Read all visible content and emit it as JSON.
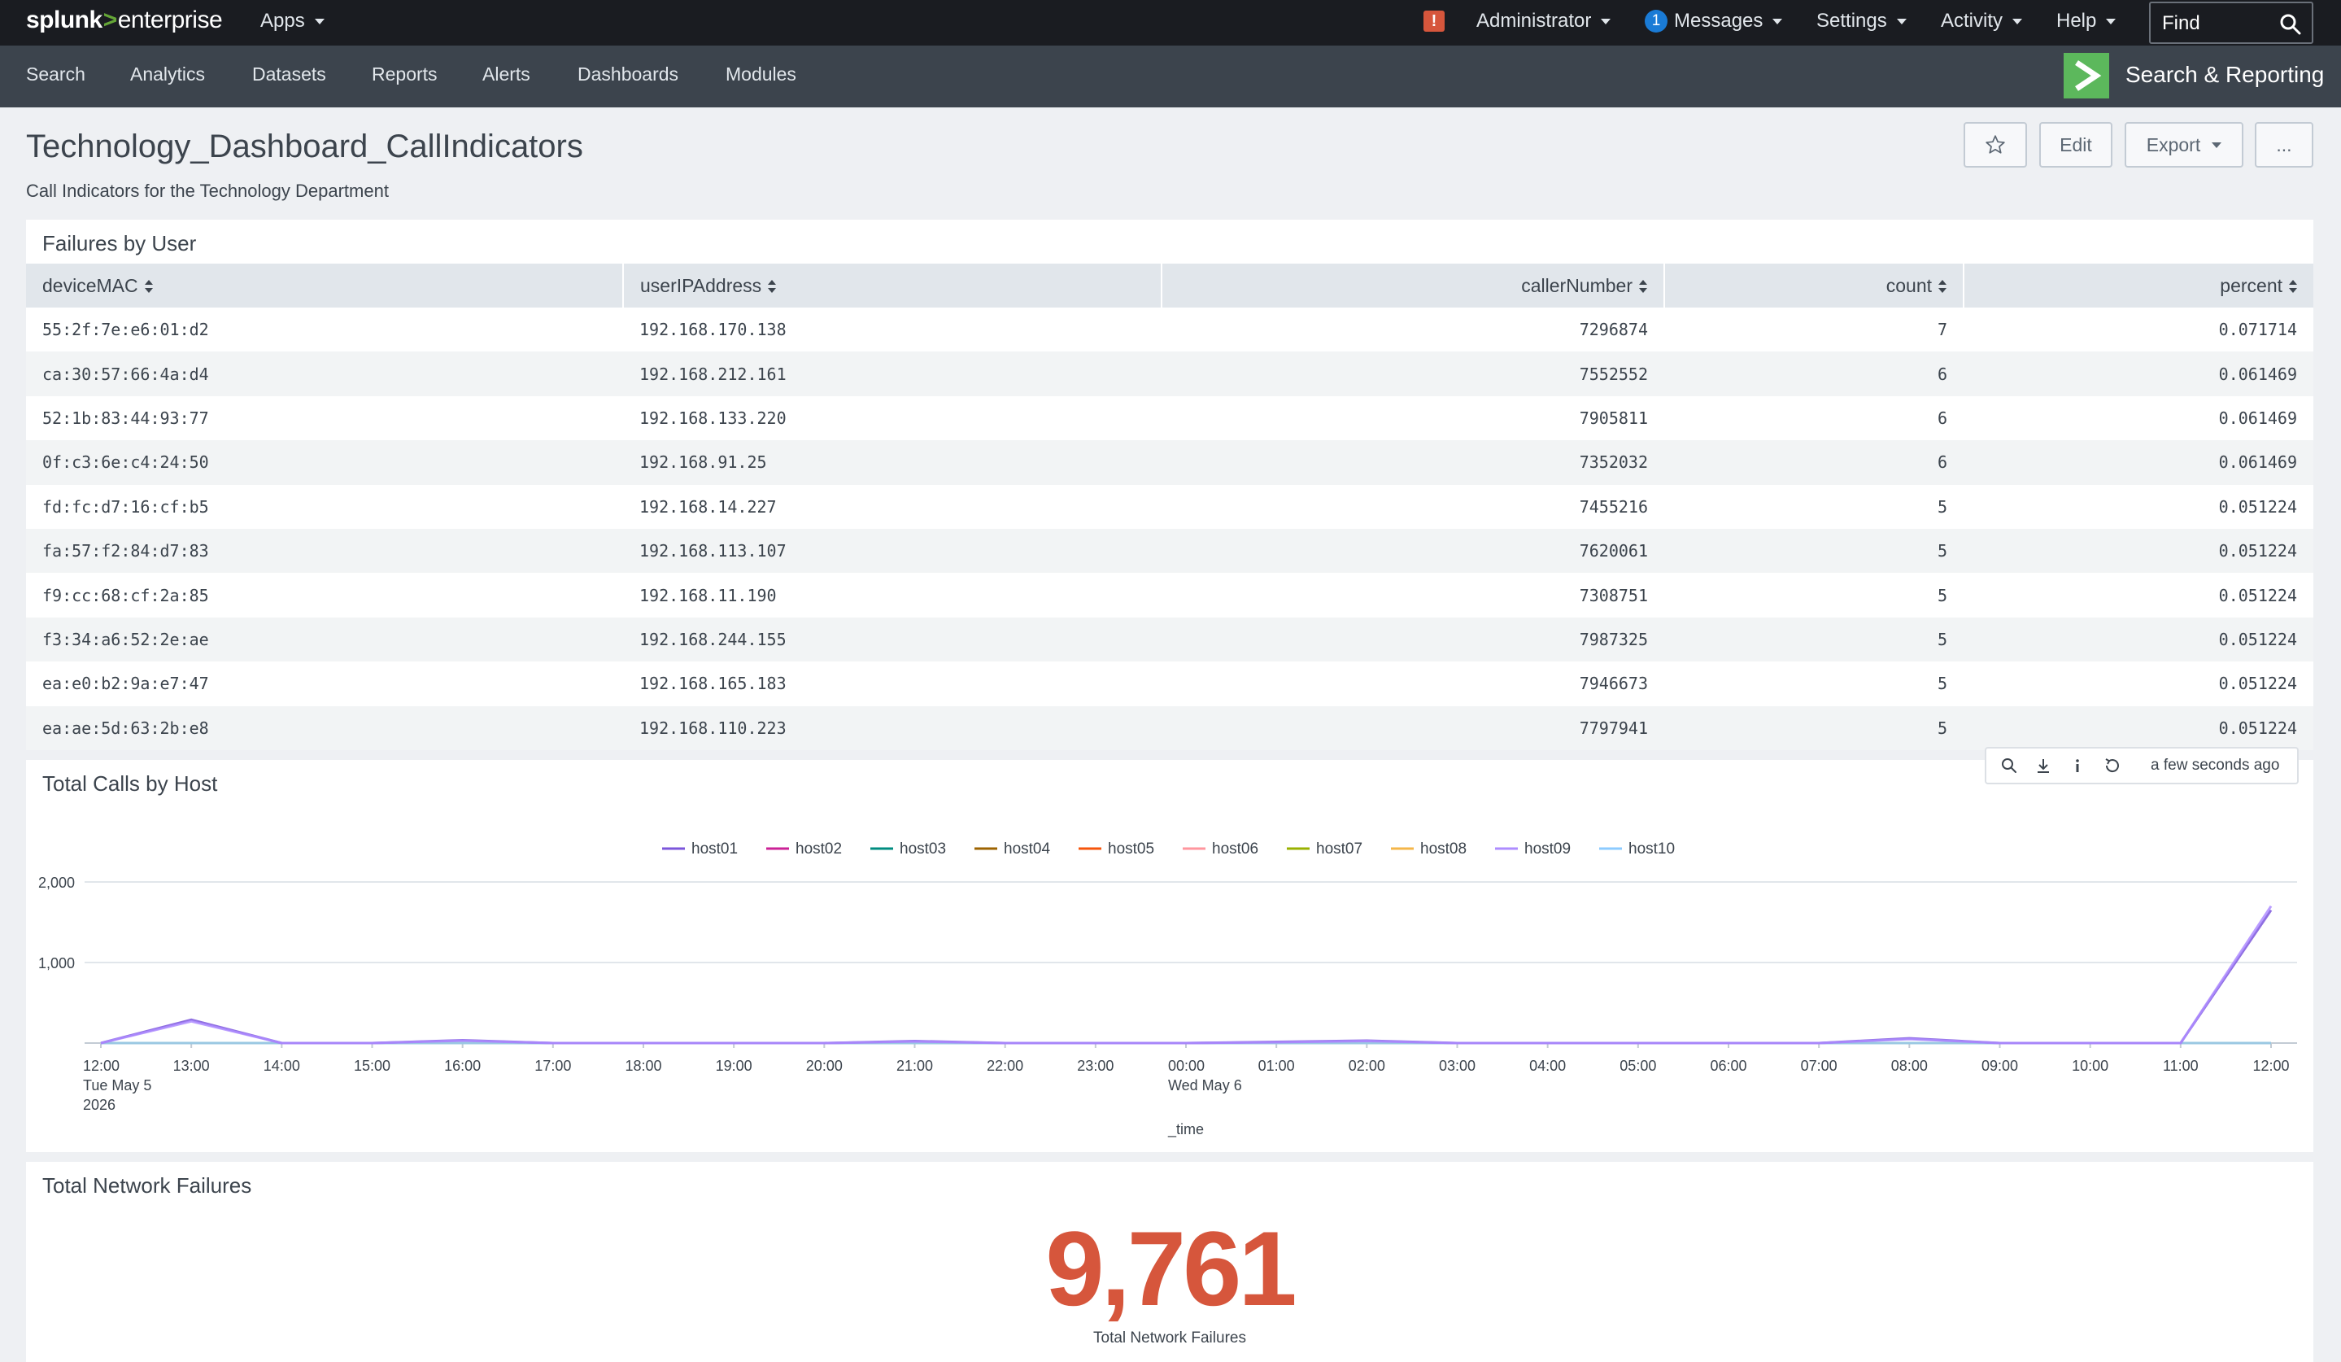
{
  "topbar": {
    "logo_splunk": "splunk",
    "logo_gt": ">",
    "logo_enterprise": "enterprise",
    "apps": "Apps",
    "alert_icon": "!",
    "user": "Administrator",
    "messages_count": "1",
    "messages": "Messages",
    "settings": "Settings",
    "activity": "Activity",
    "help": "Help",
    "find_placeholder": "Find"
  },
  "appbar": {
    "nav": [
      "Search",
      "Analytics",
      "Datasets",
      "Reports",
      "Alerts",
      "Dashboards",
      "Modules"
    ],
    "app_name": "Search & Reporting",
    "app_logo_color": "#5cb85c"
  },
  "dashboard": {
    "title": "Technology_Dashboard_CallIndicators",
    "description": "Call Indicators for the Technology Department",
    "buttons": {
      "edit": "Edit",
      "export": "Export",
      "more": "..."
    }
  },
  "failures_panel": {
    "title": "Failures by User",
    "columns": [
      "deviceMAC",
      "userIPAddress",
      "callerNumber",
      "count",
      "percent"
    ],
    "rows": [
      [
        "55:2f:7e:e6:01:d2",
        "192.168.170.138",
        "7296874",
        "7",
        "0.071714"
      ],
      [
        "ca:30:57:66:4a:d4",
        "192.168.212.161",
        "7552552",
        "6",
        "0.061469"
      ],
      [
        "52:1b:83:44:93:77",
        "192.168.133.220",
        "7905811",
        "6",
        "0.061469"
      ],
      [
        "0f:c3:6e:c4:24:50",
        "192.168.91.25",
        "7352032",
        "6",
        "0.061469"
      ],
      [
        "fd:fc:d7:16:cf:b5",
        "192.168.14.227",
        "7455216",
        "5",
        "0.051224"
      ],
      [
        "fa:57:f2:84:d7:83",
        "192.168.113.107",
        "7620061",
        "5",
        "0.051224"
      ],
      [
        "f9:cc:68:cf:2a:85",
        "192.168.11.190",
        "7308751",
        "5",
        "0.051224"
      ],
      [
        "f3:34:a6:52:2e:ae",
        "192.168.244.155",
        "7987325",
        "5",
        "0.051224"
      ],
      [
        "ea:e0:b2:9a:e7:47",
        "192.168.165.183",
        "7946673",
        "5",
        "0.051224"
      ],
      [
        "ea:ae:5d:63:2b:e8",
        "192.168.110.223",
        "7797941",
        "5",
        "0.051224"
      ]
    ]
  },
  "chart_toolbar": {
    "timestamp": "a few seconds ago"
  },
  "calls_panel": {
    "title": "Total Calls by Host"
  },
  "chart_data": {
    "type": "line",
    "title": "Total Calls by Host",
    "xlabel": "_time",
    "ylabel": "",
    "ylim": [
      0,
      2000
    ],
    "yticks": [
      {
        "value": 1000,
        "label": "1,000"
      },
      {
        "value": 2000,
        "label": "2,000"
      }
    ],
    "grid": true,
    "legend_position": "top",
    "x": [
      "12:00",
      "13:00",
      "14:00",
      "15:00",
      "16:00",
      "17:00",
      "18:00",
      "19:00",
      "20:00",
      "21:00",
      "22:00",
      "23:00",
      "00:00",
      "01:00",
      "02:00",
      "03:00",
      "04:00",
      "05:00",
      "06:00",
      "07:00",
      "08:00",
      "09:00",
      "10:00",
      "11:00",
      "12:00"
    ],
    "x_sublabels": [
      {
        "index": 0,
        "lines": [
          "Tue May 5",
          "2026"
        ]
      },
      {
        "index": 12,
        "lines": [
          "Wed May 6"
        ]
      }
    ],
    "series": [
      {
        "name": "host01",
        "color": "#7b56db",
        "values": [
          0,
          290,
          0,
          0,
          35,
          0,
          0,
          0,
          0,
          25,
          0,
          0,
          0,
          15,
          30,
          0,
          0,
          0,
          0,
          0,
          60,
          0,
          0,
          0,
          1650
        ]
      },
      {
        "name": "host02",
        "color": "#cb2196",
        "values": [
          0,
          0,
          0,
          0,
          0,
          0,
          0,
          0,
          0,
          0,
          0,
          0,
          0,
          0,
          0,
          0,
          0,
          0,
          0,
          0,
          0,
          0,
          0,
          0,
          0
        ]
      },
      {
        "name": "host03",
        "color": "#008c80",
        "values": [
          0,
          0,
          0,
          0,
          0,
          0,
          0,
          0,
          0,
          0,
          0,
          0,
          0,
          0,
          0,
          0,
          0,
          0,
          0,
          0,
          0,
          0,
          0,
          0,
          0
        ]
      },
      {
        "name": "host04",
        "color": "#9d6300",
        "values": [
          0,
          0,
          0,
          0,
          0,
          0,
          0,
          0,
          0,
          0,
          0,
          0,
          0,
          0,
          0,
          0,
          0,
          0,
          0,
          0,
          0,
          0,
          0,
          0,
          0
        ]
      },
      {
        "name": "host05",
        "color": "#f6540b",
        "values": [
          0,
          0,
          0,
          0,
          0,
          0,
          0,
          0,
          0,
          0,
          0,
          0,
          0,
          0,
          0,
          0,
          0,
          0,
          0,
          0,
          0,
          0,
          0,
          0,
          0
        ]
      },
      {
        "name": "host06",
        "color": "#ff969e",
        "values": [
          0,
          0,
          0,
          0,
          0,
          0,
          0,
          0,
          0,
          0,
          0,
          0,
          0,
          0,
          0,
          0,
          0,
          0,
          0,
          0,
          0,
          0,
          0,
          0,
          0
        ]
      },
      {
        "name": "host07",
        "color": "#99b100",
        "values": [
          0,
          0,
          0,
          0,
          0,
          0,
          0,
          0,
          0,
          0,
          0,
          0,
          0,
          0,
          0,
          0,
          0,
          0,
          0,
          0,
          0,
          0,
          0,
          0,
          0
        ]
      },
      {
        "name": "host08",
        "color": "#f4b649",
        "values": [
          0,
          0,
          0,
          0,
          0,
          0,
          0,
          0,
          0,
          0,
          0,
          0,
          0,
          0,
          0,
          0,
          0,
          0,
          0,
          0,
          0,
          0,
          0,
          0,
          0
        ]
      },
      {
        "name": "host09",
        "color": "#ae8cff",
        "values": [
          0,
          270,
          0,
          0,
          30,
          0,
          0,
          0,
          0,
          20,
          0,
          0,
          0,
          10,
          25,
          0,
          0,
          0,
          0,
          0,
          50,
          0,
          0,
          0,
          1700
        ]
      },
      {
        "name": "host10",
        "color": "#8ccbff",
        "values": [
          0,
          0,
          0,
          0,
          0,
          0,
          0,
          0,
          0,
          0,
          0,
          0,
          0,
          0,
          0,
          0,
          0,
          0,
          0,
          0,
          0,
          0,
          0,
          0,
          0
        ]
      }
    ]
  },
  "network_panel": {
    "title": "Total Network Failures",
    "value": "9,761",
    "label": "Total Network Failures",
    "value_color": "#d6563c"
  }
}
